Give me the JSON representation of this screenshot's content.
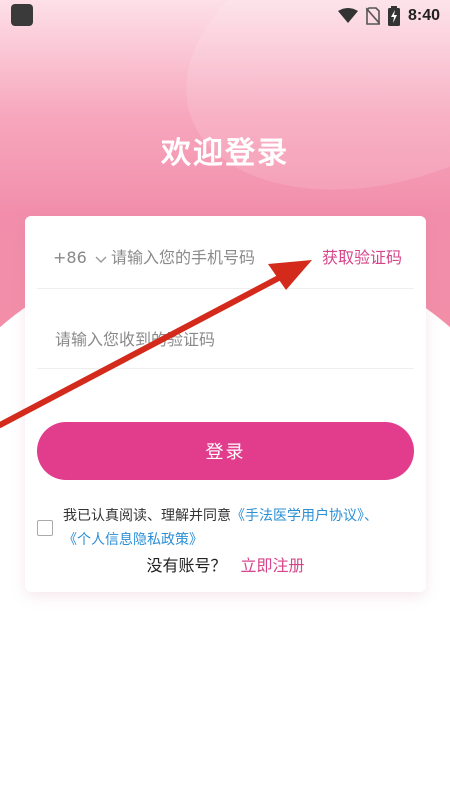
{
  "status_bar": {
    "time": "8:40",
    "icons": [
      "app-icon",
      "wifi-icon",
      "no-sim-icon",
      "battery-charging-icon"
    ]
  },
  "title": "欢迎登录",
  "form": {
    "country_code": "+86",
    "phone_placeholder": "请输入您的手机号码",
    "get_code_label": "获取验证码",
    "code_placeholder": "请输入您收到的验证码"
  },
  "login_label": "登录",
  "agreement": {
    "prefix": "我已认真阅读、理解并同意",
    "user_agreement": "《手法医学用户协议》",
    "separator": "、",
    "privacy_policy": "《个人信息隐私政策》"
  },
  "register": {
    "prompt": "没有账号？",
    "link_label": "立即注册"
  },
  "colors": {
    "accent": "#e23c8c",
    "link_pink": "#d6458a",
    "link_blue": "#2b8fd6",
    "hero_pink": "#f28eab",
    "annotation_red": "#d42a1c"
  }
}
